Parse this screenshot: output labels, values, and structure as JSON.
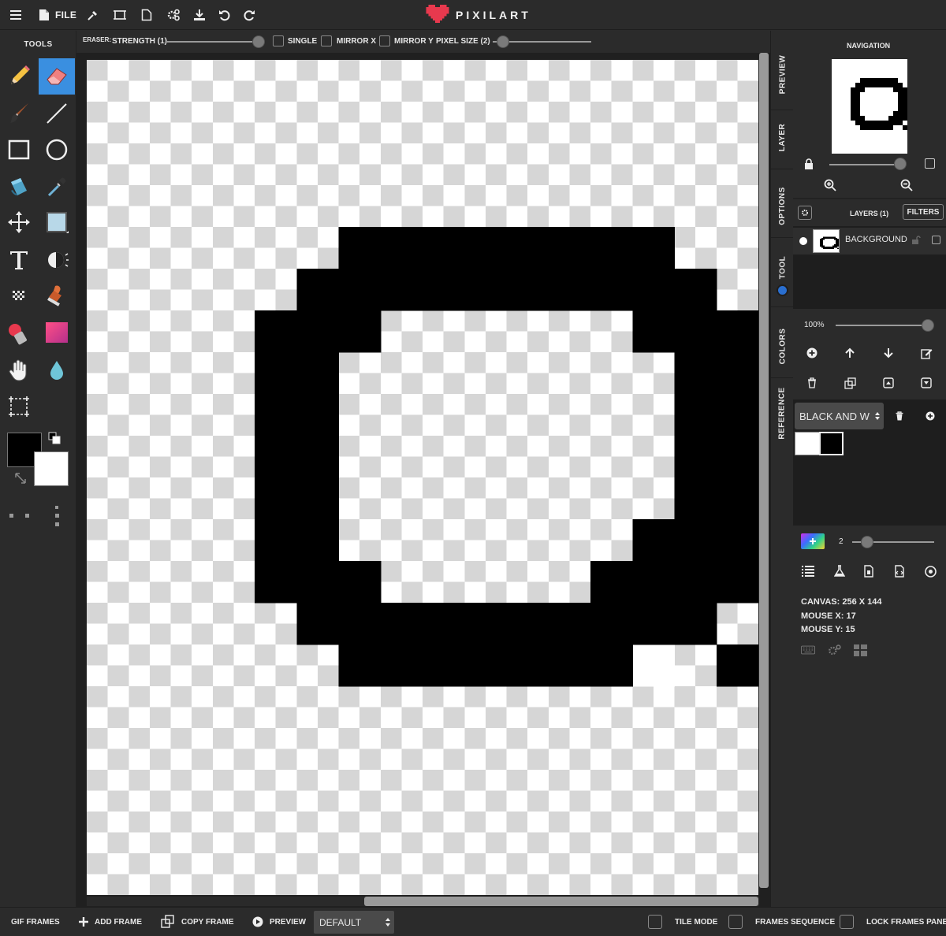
{
  "app": {
    "logo_text": "PIXILART",
    "brand_color": "#e8394e"
  },
  "topbar": {
    "file_label": "FILE",
    "icons": [
      "menu-icon",
      "file-icon",
      "eyedropper-icon",
      "resize-icon",
      "new-page-icon",
      "settings-icon",
      "download-icon",
      "undo-icon",
      "redo-icon"
    ]
  },
  "tools": {
    "title": "TOOLS",
    "active": "eraser",
    "primary_color": "#000000",
    "secondary_color": "#ffffff"
  },
  "options_bar": {
    "tool_name": "ERASER:",
    "strength_label": "STRENGTH (1)",
    "single_label": "SINGLE",
    "mirror_x_label": "MIRROR X",
    "mirror_y_label": "MIRROR Y",
    "pixel_size_label": "PIXEL SIZE (2)",
    "strength_value": 1,
    "pixel_size_value": 2
  },
  "canvas": {
    "checker_light": "#ffffff",
    "checker_dark": "#d6d6d6",
    "ink": "#000000",
    "grid_cols": 16,
    "grid_rows": 20,
    "pixels": [
      "................",
      "................",
      "................",
      "................",
      "......########..",
      ".....##########.",
      "....###......###",
      "....##........##",
      "....##........##",
      "....##........##",
      "....##........##",
      "....##.......###",
      "....###.....####",
      ".....##########.",
      "......#######..#",
      "................",
      "................",
      "................",
      "................",
      "................"
    ],
    "white_cells": [
      [
        13,
        14
      ],
      [
        14,
        13
      ]
    ]
  },
  "vtabs": {
    "preview": "PREVIEW",
    "layer": "LAYER",
    "options": "OPTIONS",
    "tool": "TOOL",
    "colors": "COLORS",
    "reference": "REFERENCE"
  },
  "navigation": {
    "title": "NAVIGATION"
  },
  "layers": {
    "title": "LAYERS (1)",
    "filters_label": "FILTERS",
    "items": [
      {
        "name": "BACKGROUND"
      }
    ],
    "opacity_label": "100%",
    "opacity_value": 100
  },
  "palette": {
    "name": "BLACK AND W",
    "swatches": [
      "#ffffff",
      "#000000"
    ]
  },
  "brush": {
    "size_label": "2",
    "size_value": 2
  },
  "info": {
    "canvas_size": "CANVAS: 256 X 144",
    "mouse_x": "MOUSE X: 17",
    "mouse_y": "MOUSE Y: 15"
  },
  "bottombar": {
    "gif_frames": "GIF FRAMES",
    "add_frame": "ADD FRAME",
    "copy_frame": "COPY FRAME",
    "preview": "PREVIEW",
    "frame_mode": "DEFAULT",
    "tile_mode": "TILE MODE",
    "frames_sequence": "FRAMES SEQUENCE",
    "lock_frames_panel": "LOCK FRAMES PANEL"
  }
}
